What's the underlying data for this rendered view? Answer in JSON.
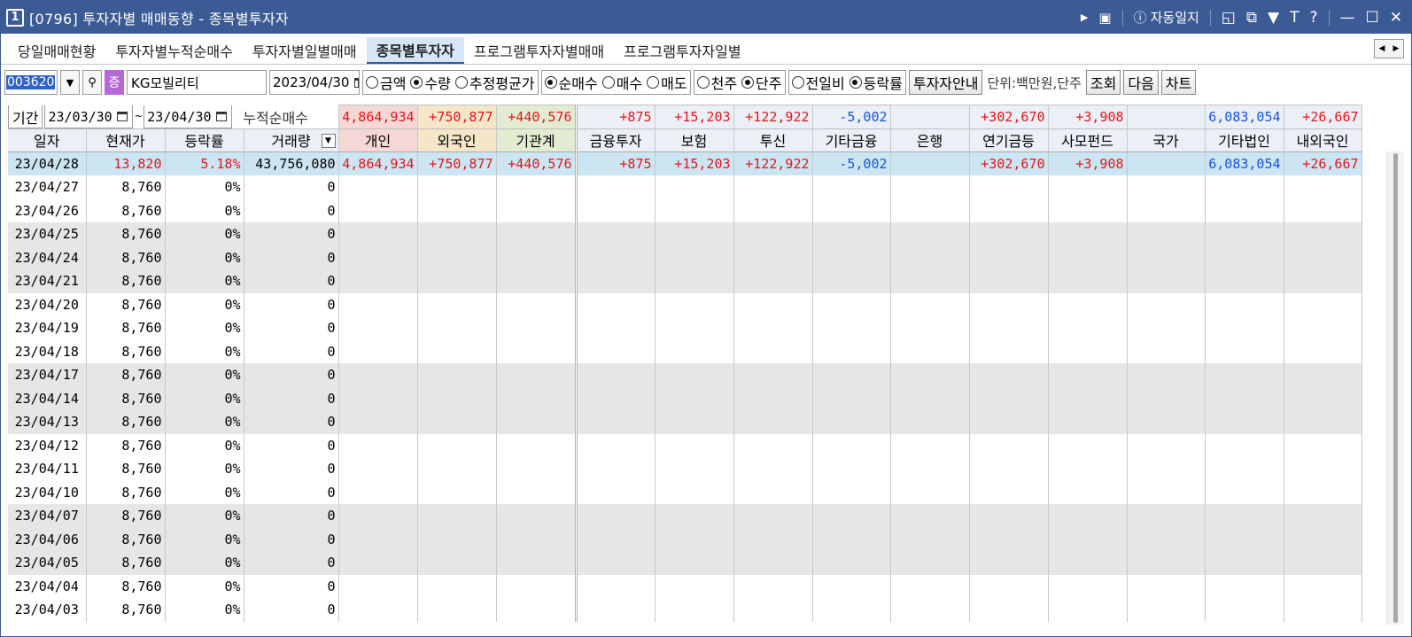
{
  "window": {
    "number": "1",
    "title": "[0796] 투자자별 매매동향 - 종목별투자자",
    "auto_log": "자동일지",
    "icons": [
      "play-icon",
      "screen-icon",
      "info-icon",
      "layout-icon",
      "copy-window-icon",
      "pin-icon",
      "text-icon",
      "help-icon",
      "minimize-icon",
      "maximize-icon",
      "close-icon"
    ]
  },
  "tabs": [
    "당일매매현황",
    "투자자별누적순매수",
    "투자자별일별매매",
    "종목별투자자",
    "프로그램투자자별매매",
    "프로그램투자자일별"
  ],
  "active_tab": 3,
  "toolbar": {
    "code": "003620",
    "badge": "증",
    "stock_name": "KG모빌리티",
    "date": "2023/04/30",
    "group1": [
      {
        "label": "금액",
        "on": false
      },
      {
        "label": "수량",
        "on": true
      },
      {
        "label": "추정평균가",
        "on": false
      }
    ],
    "group2": [
      {
        "label": "순매수",
        "on": true
      },
      {
        "label": "매수",
        "on": false
      },
      {
        "label": "매도",
        "on": false
      }
    ],
    "group3": [
      {
        "label": "천주",
        "on": false
      },
      {
        "label": "단주",
        "on": true
      }
    ],
    "group4": [
      {
        "label": "전일비",
        "on": false
      },
      {
        "label": "등락률",
        "on": true
      }
    ],
    "guide_button": "투자자안내",
    "unit": "단위:백만원,단주",
    "buttons": [
      "조회",
      "다음",
      "차트"
    ]
  },
  "range": {
    "label": "기간",
    "from": "23/03/30",
    "tilde": "~",
    "to": "23/04/30",
    "sum_label": "누적순매수"
  },
  "summary": [
    "4,864,934",
    "+750,877",
    "+440,576",
    "+875",
    "+15,203",
    "+122,922",
    "-5,002",
    "",
    "+302,670",
    "+3,908",
    "",
    "6,083,054",
    "+26,667"
  ],
  "columns": [
    "일자",
    "현재가",
    "등락률",
    "거래량",
    "개인",
    "외국인",
    "기관계",
    "금융투자",
    "보험",
    "투신",
    "기타금융",
    "은행",
    "연기금등",
    "사모펀드",
    "국가",
    "기타법인",
    "내외국인"
  ],
  "rows": [
    [
      "23/04/28",
      "13,820",
      "5.18%",
      "43,756,080",
      "4,864,934",
      "+750,877",
      "+440,576",
      "+875",
      "+15,203",
      "+122,922",
      "-5,002",
      "",
      "+302,670",
      "+3,908",
      "",
      "6,083,054",
      "+26,667"
    ],
    [
      "23/04/27",
      "8,760",
      "0%",
      "0"
    ],
    [
      "23/04/26",
      "8,760",
      "0%",
      "0"
    ],
    [
      "23/04/25",
      "8,760",
      "0%",
      "0"
    ],
    [
      "23/04/24",
      "8,760",
      "0%",
      "0"
    ],
    [
      "23/04/21",
      "8,760",
      "0%",
      "0"
    ],
    [
      "23/04/20",
      "8,760",
      "0%",
      "0"
    ],
    [
      "23/04/19",
      "8,760",
      "0%",
      "0"
    ],
    [
      "23/04/18",
      "8,760",
      "0%",
      "0"
    ],
    [
      "23/04/17",
      "8,760",
      "0%",
      "0"
    ],
    [
      "23/04/14",
      "8,760",
      "0%",
      "0"
    ],
    [
      "23/04/13",
      "8,760",
      "0%",
      "0"
    ],
    [
      "23/04/12",
      "8,760",
      "0%",
      "0"
    ],
    [
      "23/04/11",
      "8,760",
      "0%",
      "0"
    ],
    [
      "23/04/10",
      "8,760",
      "0%",
      "0"
    ],
    [
      "23/04/07",
      "8,760",
      "0%",
      "0"
    ],
    [
      "23/04/06",
      "8,760",
      "0%",
      "0"
    ],
    [
      "23/04/05",
      "8,760",
      "0%",
      "0"
    ],
    [
      "23/04/04",
      "8,760",
      "0%",
      "0"
    ],
    [
      "23/04/03",
      "8,760",
      "0%",
      "0"
    ]
  ],
  "colors": {
    "title_bar": "#3c5b95",
    "positive": "#e8141c",
    "negative": "#1952d8",
    "selected_row": "#cbe6f2"
  }
}
